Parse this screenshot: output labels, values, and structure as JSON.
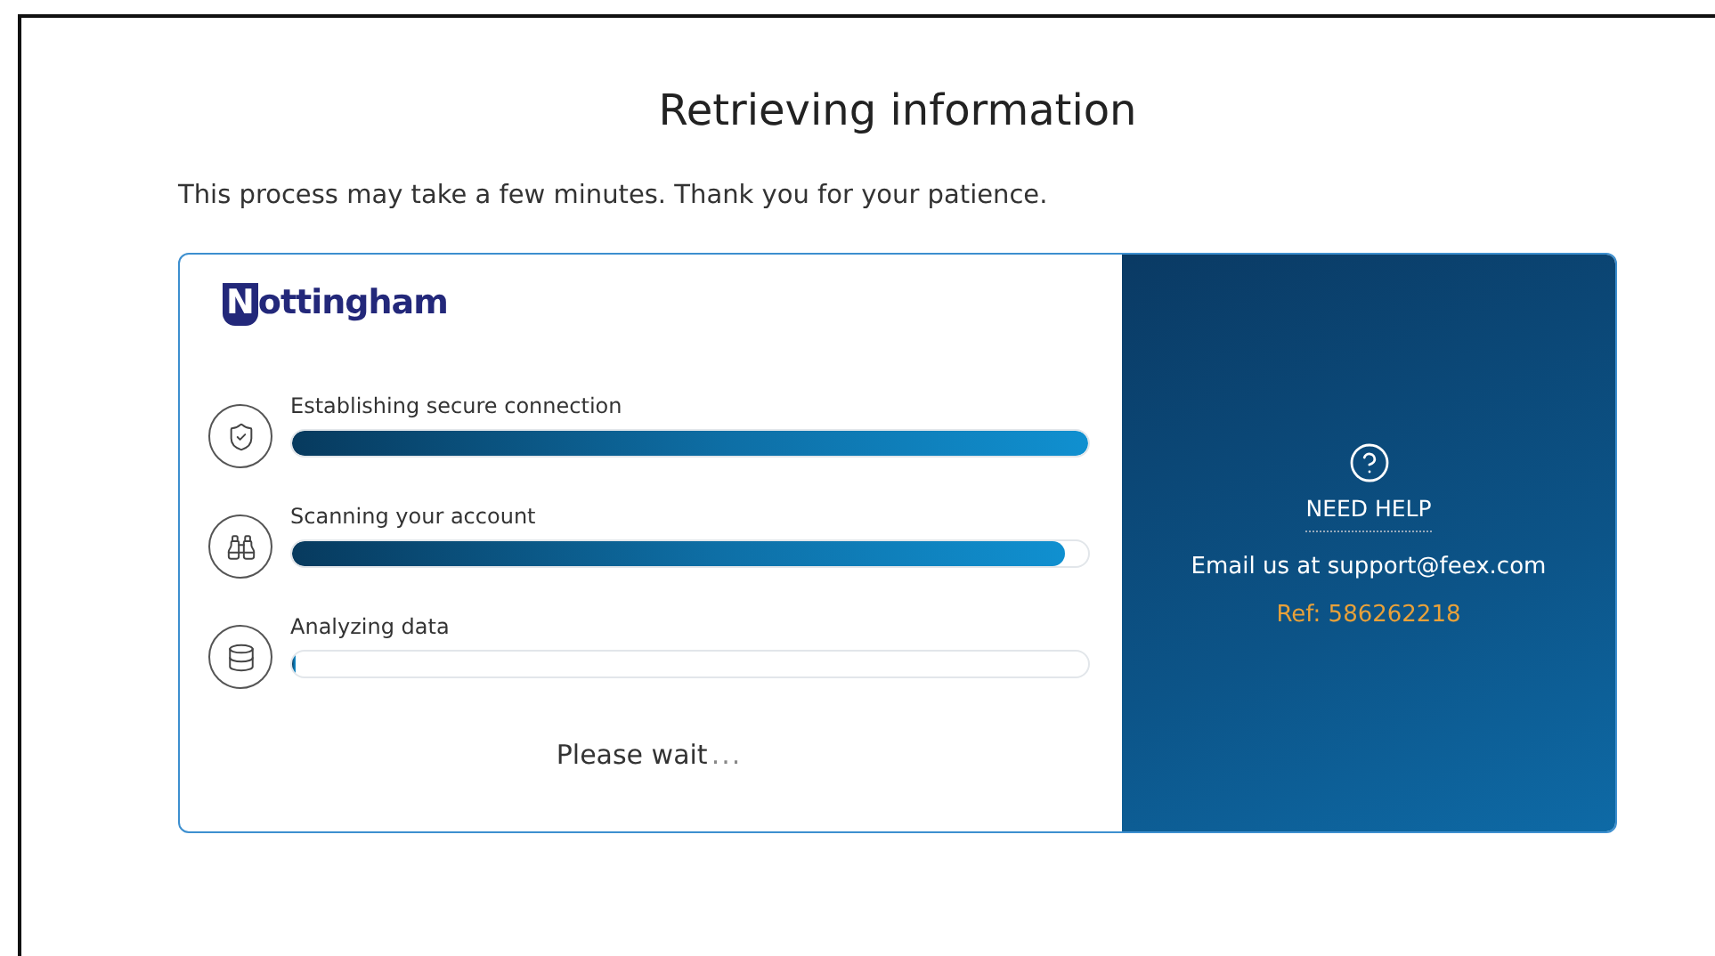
{
  "title": "Retrieving information",
  "intro": "This process may take a few minutes. Thank you for your patience.",
  "logo": {
    "mark": "N",
    "text": "ottingham"
  },
  "steps": [
    {
      "kind": "shield",
      "label": "Establishing secure connection",
      "level": 1
    },
    {
      "kind": "binoculars",
      "label": "Scanning your account",
      "level": 0.97
    },
    {
      "kind": "database",
      "label": "Analyzing data",
      "level": 0
    }
  ],
  "status": {
    "text": "Please wait",
    "ellipsis": "..."
  },
  "help": {
    "heading": "NEED HELP",
    "email_text": "Email us at support@feex.com",
    "reference": "Ref: 586262218"
  }
}
